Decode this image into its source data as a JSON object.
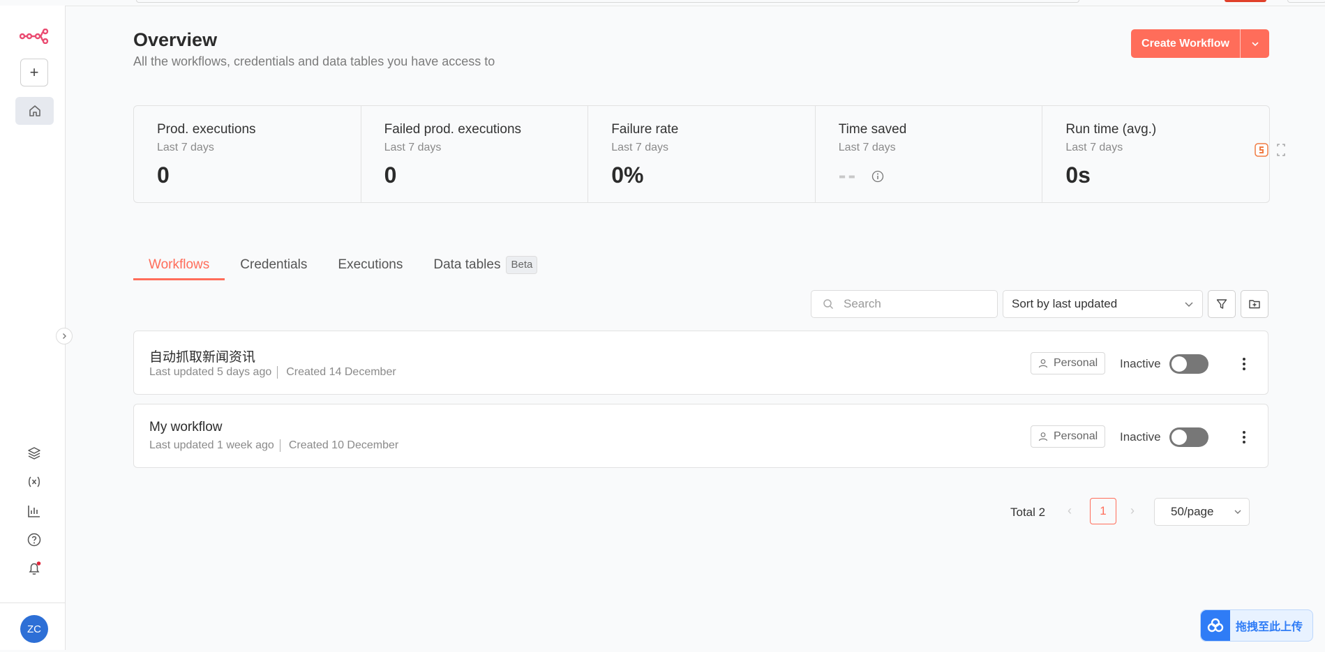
{
  "colors": {
    "accent": "#ff6d5a",
    "avatar": "#2d6fd6",
    "upload": "#2f7cf6"
  },
  "sidebar": {
    "logo_icon": "n8n-logo-icon",
    "avatar_initials": "ZC",
    "icons": [
      "plus-icon",
      "home-icon",
      "templates-icon",
      "variables-icon",
      "insights-icon",
      "help-icon",
      "bell-icon"
    ]
  },
  "header": {
    "title": "Overview",
    "subtitle": "All the workflows, credentials and data tables you have access to",
    "create_button": "Create Workflow"
  },
  "stats": [
    {
      "label": "Prod. executions",
      "period": "Last 7 days",
      "value": "0"
    },
    {
      "label": "Failed prod. executions",
      "period": "Last 7 days",
      "value": "0"
    },
    {
      "label": "Failure rate",
      "period": "Last 7 days",
      "value": "0%"
    },
    {
      "label": "Time saved",
      "period": "Last 7 days",
      "value": "--"
    },
    {
      "label": "Run time (avg.)",
      "period": "Last 7 days",
      "value": "0s"
    }
  ],
  "tabs": [
    {
      "label": "Workflows",
      "active": true
    },
    {
      "label": "Credentials"
    },
    {
      "label": "Executions"
    },
    {
      "label": "Data tables",
      "badge": "Beta"
    }
  ],
  "toolbar": {
    "search_placeholder": "Search",
    "sort_value": "Sort by last updated"
  },
  "workflows": [
    {
      "name": "自动抓取新闻资讯",
      "updated": "Last updated 5 days ago",
      "created": "Created 14 December",
      "owner": "Personal",
      "status": "Inactive",
      "active": false
    },
    {
      "name": "My workflow",
      "updated": "Last updated 1 week ago",
      "created": "Created 10 December",
      "owner": "Personal",
      "status": "Inactive",
      "active": false
    }
  ],
  "pagination": {
    "total": "Total 2",
    "current_page": "1",
    "per_page": "50/page"
  },
  "upload_widget": {
    "label": "拖拽至此上传"
  }
}
